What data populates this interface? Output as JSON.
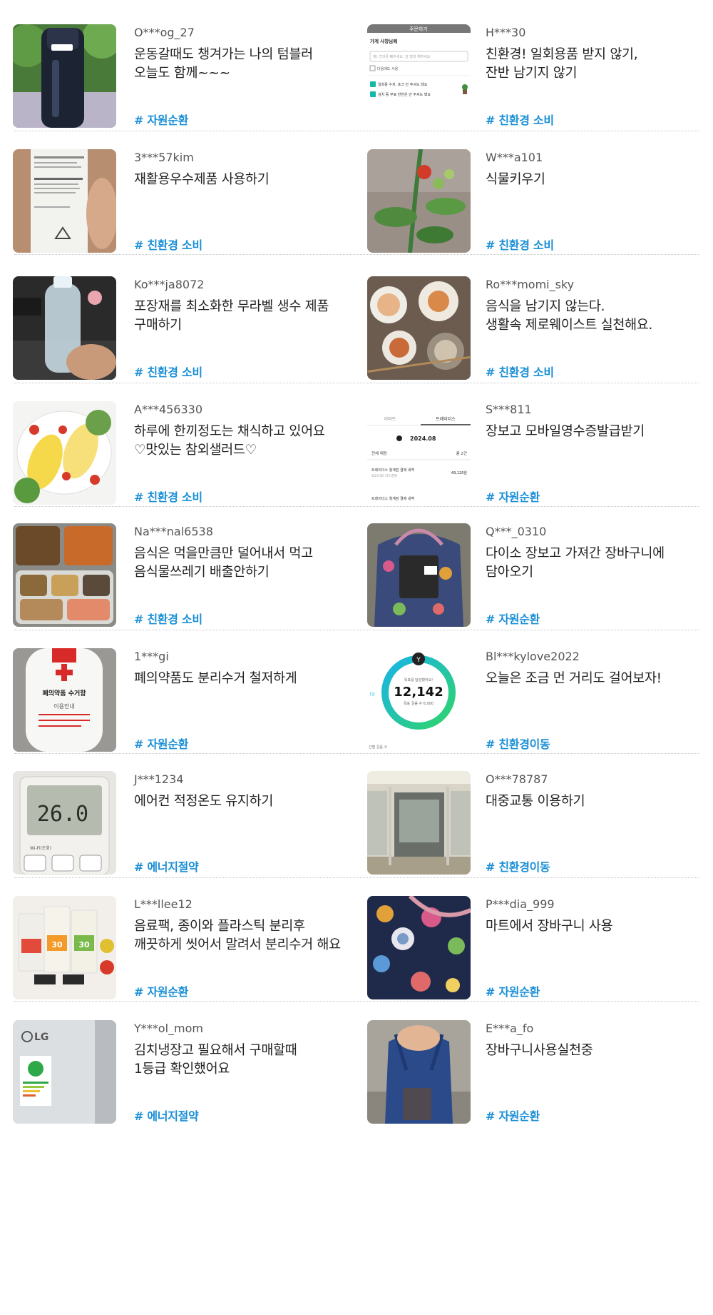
{
  "posts": [
    {
      "user": "O***og_27",
      "text": "운동갈때도 챙겨가는 나의 텀블러\n오늘도 함께~~~",
      "tag": "# 자원순환",
      "image": "tumbler-photo"
    },
    {
      "user": "H***30",
      "text": "친환경! 일회용품 받지 않기,\n잔반 남기지 않기",
      "tag": "# 친환경 소비",
      "image": "order-screen-screenshot"
    },
    {
      "user": "3***57kim",
      "text": "재활용우수제품 사용하기",
      "tag": "# 친환경 소비",
      "image": "recycled-tube-photo"
    },
    {
      "user": "W***a101",
      "text": "식물키우기",
      "tag": "# 친환경 소비",
      "image": "tomato-plant-photo"
    },
    {
      "user": "Ko***ja8072",
      "text": "포장재를 최소화한 무라벨 생수 제품\n구매하기",
      "tag": "# 친환경 소비",
      "image": "label-free-water-bottle-photo"
    },
    {
      "user": "Ro***momi_sky",
      "text": "음식을 남기지 않는다.\n생활속 제로웨이스트 실천해요.",
      "tag": "# 친환경 소비",
      "image": "empty-dishes-photo"
    },
    {
      "user": "A***456330",
      "text": "하루에 한끼정도는 채식하고 있어요\n♡맛있는 참외샐러드♡",
      "tag": "# 친환경 소비",
      "image": "melon-salad-photo"
    },
    {
      "user": "S***811",
      "text": "장보고 모바일영수증발급받기",
      "tag": "# 자원순환",
      "image": "mobile-receipt-screenshot"
    },
    {
      "user": "Na***nal6538",
      "text": "음식은 먹을만큼만 덜어내서 먹고\n음식물쓰레기 배출안하기",
      "tag": "# 친환경 소비",
      "image": "meal-tray-photo"
    },
    {
      "user": "Q***_0310",
      "text": "다이소 장보고 가져간 장바구니에\n담아오기",
      "tag": "# 자원순환",
      "image": "shopping-bag-photo"
    },
    {
      "user": "1***gi",
      "text": "폐의약품도 분리수거 철저하게",
      "tag": "# 자원순환",
      "image": "medicine-collection-box-photo"
    },
    {
      "user": "Bl***kylove2022",
      "text": "오늘은 조금 먼 거리도 걸어보자!",
      "tag": "# 친환경이동",
      "image": "step-counter-screenshot"
    },
    {
      "user": "J***1234",
      "text": "에어컨 적정온도 유지하기",
      "tag": "# 에너지절약",
      "image": "aircon-remote-photo"
    },
    {
      "user": "O***78787",
      "text": "대중교통 이용하기",
      "tag": "# 친환경이동",
      "image": "subway-car-photo"
    },
    {
      "user": "L***llee12",
      "text": "음료팩, 종이와 플라스틱 분리후\n깨끗하게 씻어서 말려서 분리수거 해요",
      "tag": "# 자원순환",
      "image": "drink-pack-photo"
    },
    {
      "user": "P***dia_999",
      "text": "마트에서 장바구니 사용",
      "tag": "# 자원순환",
      "image": "floral-bag-photo"
    },
    {
      "user": "Y***ol_mom",
      "text": "김치냉장고 필요해서 구매할때\n1등급 확인했어요",
      "tag": "# 에너지절약",
      "image": "energy-label-fridge-photo"
    },
    {
      "user": "E***a_fo",
      "text": "장바구니사용실천중",
      "tag": "# 자원순환",
      "image": "carrying-bag-photo"
    }
  ],
  "thumb_text": {
    "order_title": "주문하기",
    "order_header": "가게 사장님께",
    "order_placeholder": "예) 견과류 빼주세요, 덜 맵게 해주세요",
    "order_next": "다음에도 사용",
    "order_opt1": "일회용 수저, 포크 안 주셔도 돼요",
    "order_opt2": "김치 등 무료 반찬은 안 주셔도 돼요",
    "receipt_tab1": "아마트",
    "receipt_tab2": "트레이더스",
    "receipt_month": "2024.08",
    "receipt_all": "전체 매장",
    "receipt_total": "총 2건",
    "receipt_item1": "트레이더스 월계점 결제 내역",
    "receipt_date1": "8/27(화) 카드결제",
    "receipt_amt1": "49,120원",
    "receipt_item2": "트레이더스 월계점 결제 내역",
    "steps_goal": "목표를 달성했어요!",
    "steps_value": "12,142",
    "steps_target": "목표 걸음 수 6,000",
    "steps_side": "1만",
    "steps_foot": "간별 걸음 수",
    "aircon_temp": "26.0",
    "aircon_wifi": "Wi-Fi(조회)",
    "medicine_title": "폐의약품 수거함",
    "medicine_guide": "이용안내",
    "drink_num": "30",
    "fridge_brand": "LG"
  }
}
